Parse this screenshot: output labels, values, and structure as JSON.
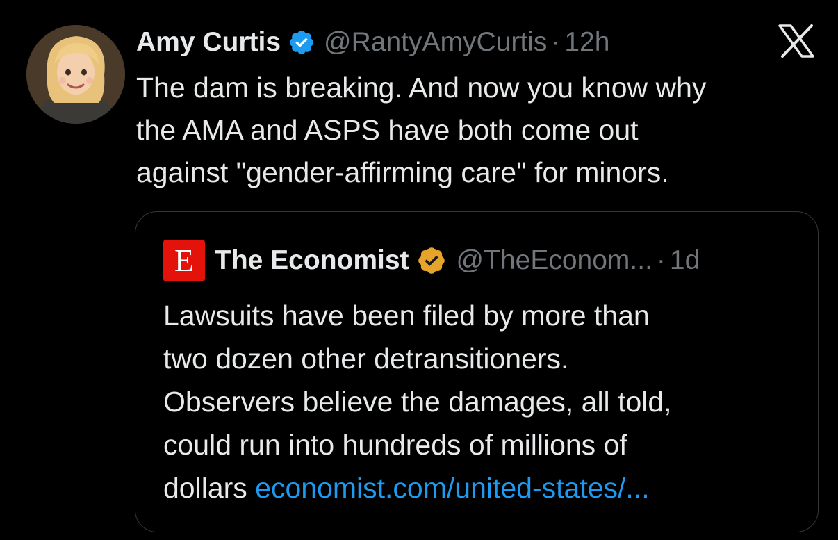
{
  "post": {
    "author": {
      "display_name": "Amy Curtis",
      "handle": "@RantyAmyCurtis",
      "verified_badge_color": "#1d9bf0"
    },
    "separator": "·",
    "time": "12h",
    "platform_icon": "x-logo-icon",
    "text_lines": [
      "The dam is breaking. And now you know why",
      "the AMA and ASPS have both come out",
      "against \"gender-affirming care\" for minors."
    ]
  },
  "quoted_post": {
    "logo_letter": "E",
    "logo_color": "#e3120b",
    "author": {
      "display_name": "The Economist",
      "handle": "@TheEconom...",
      "verified_badge_color": "#e6a42a"
    },
    "separator": "·",
    "time": "1d",
    "text_lines": [
      "Lawsuits have been filed by more than",
      "two dozen other detransitioners.",
      "Observers believe the damages, all told,",
      "could run into hundreds of millions of"
    ],
    "last_line_text": "dollars ",
    "link_text": "economist.com/united-states/..."
  },
  "colors": {
    "background": "#000000",
    "primary_text": "#e7e9ea",
    "secondary_text": "#71767b",
    "link": "#1d9bf0",
    "card_border": "#333639"
  }
}
